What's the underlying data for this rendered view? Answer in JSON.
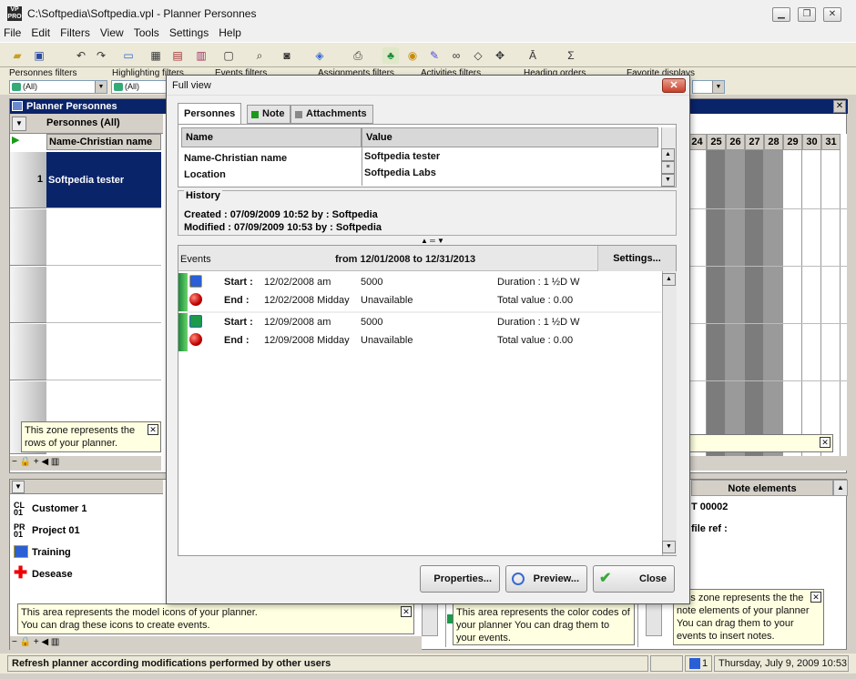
{
  "window": {
    "title": "C:\\Softpedia\\Softpedia.vpl - Planner Personnes",
    "logo": "VP PRO"
  },
  "menu": [
    "File",
    "Edit",
    "Filters",
    "View",
    "Tools",
    "Settings",
    "Help"
  ],
  "filters": {
    "labels": [
      "Personnes filters",
      "Highlighting filters",
      "Events filters",
      "Assignments filters",
      "Activities filters",
      "Heading orders",
      "Favorite displays"
    ],
    "value": "(All)"
  },
  "planner": {
    "title": "Planner Personnes",
    "group": "Personnes (All)",
    "column": "Name-Christian name",
    "row_number": "1",
    "row_name": "Softpedia tester",
    "days": [
      "24",
      "25",
      "26",
      "27",
      "28",
      "29",
      "30",
      "31"
    ],
    "tip_rows": "This zone represents the rows of your planner."
  },
  "lower": {
    "model_icons": [
      "Customer 1",
      "Project 01",
      "Training",
      "Desease"
    ],
    "model_badges": [
      "CL 01",
      "PR 01"
    ],
    "tip_models_1": "This area represents the model icons of your planner.",
    "tip_models_2": "You can drag these icons to create events.",
    "tip_colors": "This area represents the color codes of your planner You can drag them to your events.",
    "note_title": "Note elements",
    "note_code": "T 00002",
    "note_ref": "file ref :",
    "tip_notes": "This zone represents the the note elements of your planner You can drag them to your events to insert notes."
  },
  "status": {
    "message": "Refresh planner according modifications performed by other users",
    "count": "1",
    "datetime": "Thursday, July 9, 2009 10:53"
  },
  "dialog": {
    "title": "Full view",
    "tabs": [
      "Personnes",
      "Note",
      "Attachments"
    ],
    "table": {
      "headers": [
        "Name",
        "Value"
      ],
      "rows": [
        [
          "Name-Christian name",
          "Softpedia tester"
        ],
        [
          "Location",
          "Softpedia Labs"
        ]
      ]
    },
    "history": {
      "legend": "History",
      "created": "Created :  07/09/2009 10:52 by : Softpedia",
      "modified": "Modified :  07/09/2009 10:53 by : Softpedia"
    },
    "events": {
      "label": "Events",
      "range": "from 12/01/2008 to 12/31/2013",
      "settings": "Settings...",
      "items": [
        {
          "start_label": "Start :",
          "start": "12/02/2008 am",
          "code": "5000",
          "duration": "Duration :  1  ½D W",
          "end_label": "End :",
          "end": "12/02/2008 Midday",
          "status": "Unavailable",
          "total": "Total value :  0.00",
          "icon_color": "#2a5fd6"
        },
        {
          "start_label": "Start :",
          "start": "12/09/2008 am",
          "code": "5000",
          "duration": "Duration :  1  ½D W",
          "end_label": "End :",
          "end": "12/09/2008 Midday",
          "status": "Unavailable",
          "total": "Total value :  0.00",
          "icon_color": "#1a9a4a"
        }
      ]
    },
    "buttons": {
      "properties": "Properties...",
      "preview": "Preview...",
      "close": "Close"
    }
  }
}
